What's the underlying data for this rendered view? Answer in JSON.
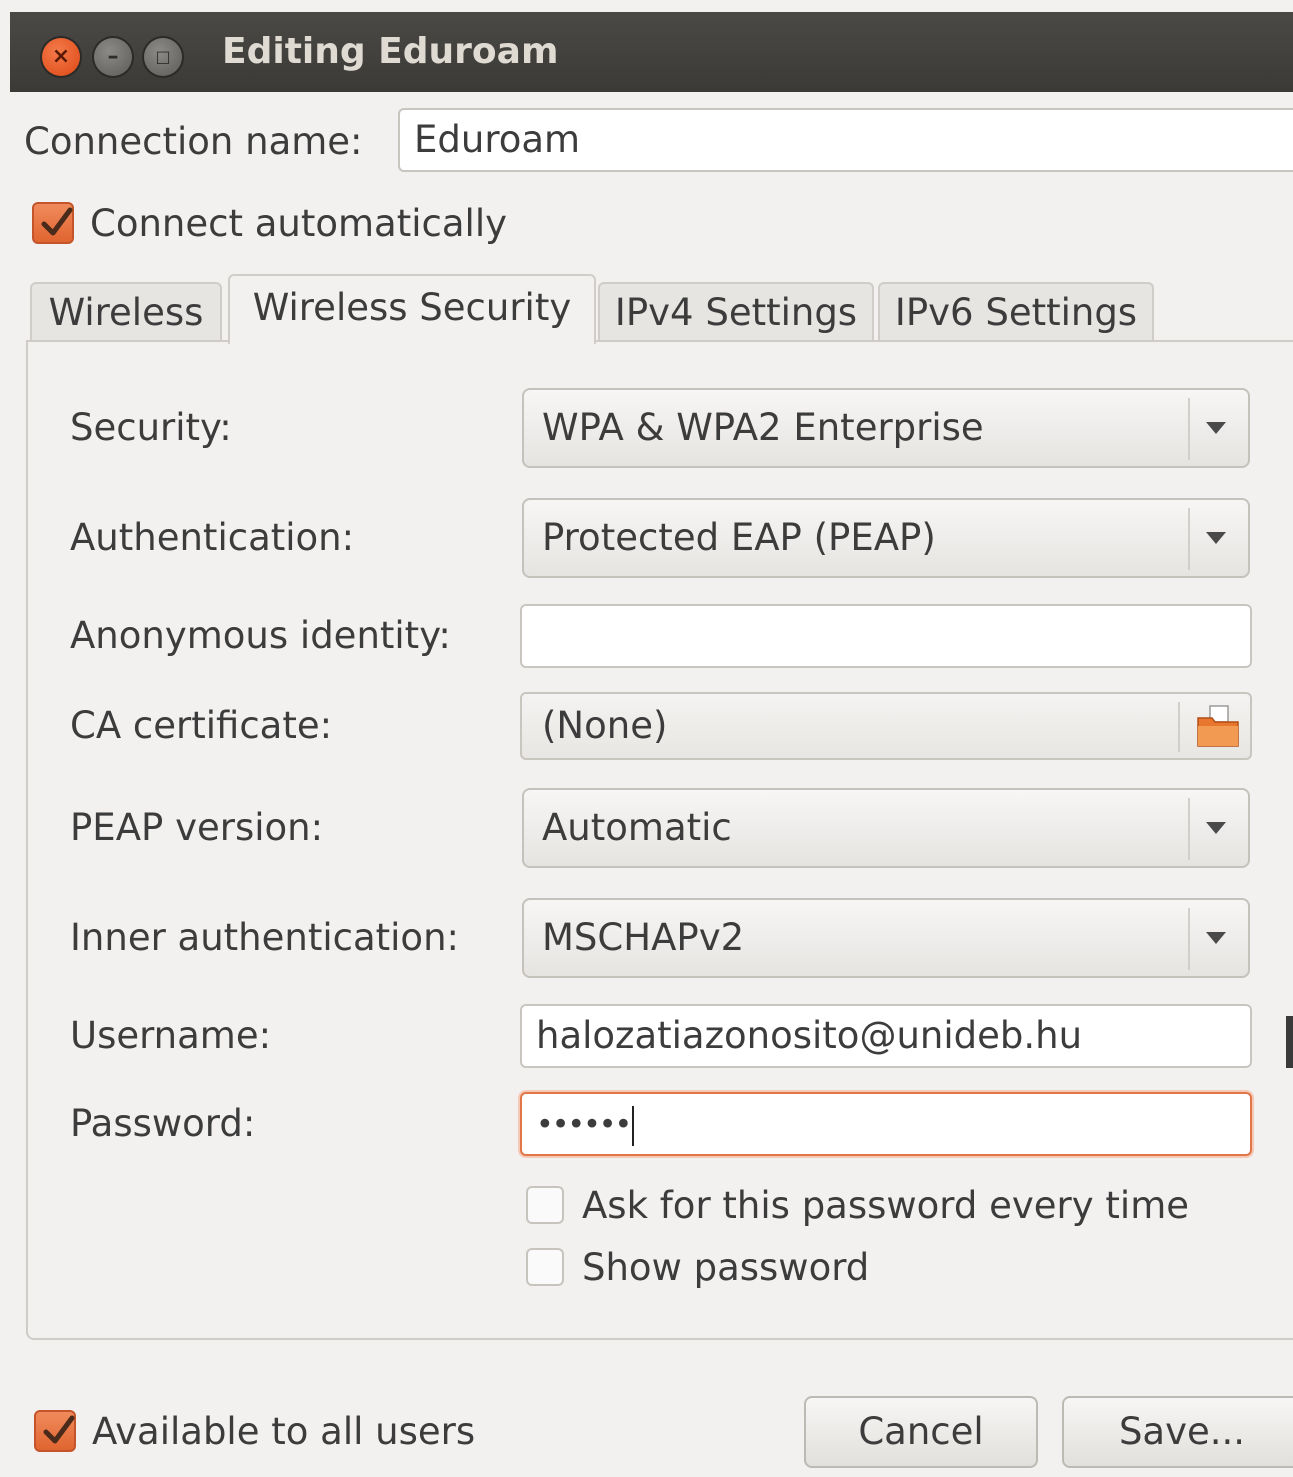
{
  "window": {
    "title": "Editing Eduroam"
  },
  "connection": {
    "name_label": "Connection name:",
    "name_value": "Eduroam",
    "auto_connect_label": "Connect automatically",
    "auto_connect_checked": true
  },
  "tabs": [
    {
      "label": "Wireless",
      "active": false
    },
    {
      "label": "Wireless Security",
      "active": true
    },
    {
      "label": "IPv4 Settings",
      "active": false
    },
    {
      "label": "IPv6 Settings",
      "active": false
    }
  ],
  "security": {
    "security_label": "Security:",
    "security_value": "WPA & WPA2 Enterprise",
    "authentication_label": "Authentication:",
    "authentication_value": "Protected EAP (PEAP)",
    "anonymous_identity_label": "Anonymous identity:",
    "anonymous_identity_value": "",
    "ca_certificate_label": "CA certificate:",
    "ca_certificate_value": "(None)",
    "peap_version_label": "PEAP version:",
    "peap_version_value": "Automatic",
    "inner_auth_label": "Inner authentication:",
    "inner_auth_value": "MSCHAPv2",
    "username_label": "Username:",
    "username_value": "halozatiazonosito@unideb.hu",
    "password_label": "Password:",
    "password_masked": "••••••",
    "ask_password_label": "Ask for this password every time",
    "ask_password_checked": false,
    "show_password_label": "Show password",
    "show_password_checked": false
  },
  "footer": {
    "available_all_users_label": "Available to all users",
    "available_all_users_checked": true,
    "cancel_label": "Cancel",
    "save_label": "Save..."
  },
  "colors": {
    "accent": "#dd4814",
    "titlebar": "#3c3b37",
    "background": "#f2f1f0"
  },
  "icons": {
    "close": "close-icon",
    "minimize": "minimize-icon",
    "maximize": "maximize-icon",
    "dropdown": "chevron-down-icon",
    "folder": "folder-icon",
    "check": "checkmark-icon"
  }
}
